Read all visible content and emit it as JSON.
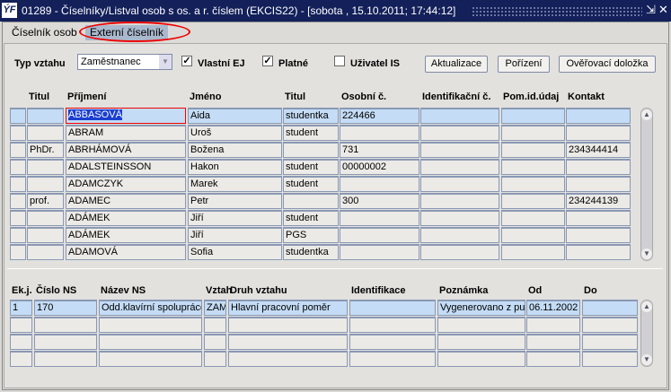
{
  "window": {
    "logo": "ÝF",
    "title": "01289 - Číselníky/Listval osob s os. a r. číslem (EKCIS22) - [sobota , 15.10.2011; 17:44:12]",
    "minimize": "⇲",
    "close": "✕"
  },
  "tabs": [
    {
      "label": "Číselník osob"
    },
    {
      "label": "Externí číselník"
    }
  ],
  "filters": {
    "typ_label": "Typ vztahu",
    "typ_value": "Zaměstnanec",
    "vlastni_ej": "Vlastní EJ",
    "vlastni_checked": true,
    "platne": "Platné",
    "platne_checked": true,
    "uzivatel": "Uživatel IS",
    "uzivatel_checked": false
  },
  "buttons": {
    "aktualizace": "Aktualizace",
    "porizeni": "Pořízení",
    "overovaci": "Ověřovací doložka"
  },
  "persons": {
    "headers": [
      "",
      "Titul",
      "Příjmení",
      "Jméno",
      "Titul",
      "Osobní č.",
      "Identifikační č.",
      "Pom.id.údaj",
      "Kontakt"
    ],
    "rows": [
      [
        "",
        "",
        "ABBASOVÁ",
        "Aida",
        "studentka",
        "224466",
        "",
        "",
        ""
      ],
      [
        "",
        "",
        "ABRAM",
        "Uroš",
        "student",
        "",
        "",
        "",
        ""
      ],
      [
        "",
        "PhDr.",
        "ABRHÁMOVÁ",
        "Božena",
        "",
        "731",
        "",
        "",
        "234344414"
      ],
      [
        "",
        "",
        "ADALSTEINSSON",
        "Hakon",
        "student",
        "00000002",
        "",
        "",
        ""
      ],
      [
        "",
        "",
        "ADAMCZYK",
        "Marek",
        "student",
        "",
        "",
        "",
        ""
      ],
      [
        "",
        "prof.",
        "ADAMEC",
        "Petr",
        "",
        "300",
        "",
        "",
        "234244139"
      ],
      [
        "",
        "",
        "ADÁMEK",
        "Jiří",
        "student",
        "",
        "",
        "",
        ""
      ],
      [
        "",
        "",
        "ADÁMEK",
        "Jiří",
        "PGS",
        "",
        "",
        "",
        ""
      ],
      [
        "",
        "",
        "ADAMOVÁ",
        "Sofia",
        "studentka",
        "",
        "",
        "",
        ""
      ]
    ]
  },
  "relations": {
    "headers": [
      "Ek.j.",
      "Číslo NS",
      "Název NS",
      "Vztah",
      "Druh vztahu",
      "Identifikace",
      "Poznámka",
      "Od",
      "Do"
    ],
    "rows": [
      [
        "1",
        "170",
        "Odd.klavírní spolupráce",
        "ZAM",
        "Hlavní pracovní poměr",
        "",
        "Vygenerovano z pu",
        "06.11.2002",
        ""
      ],
      [
        "",
        "",
        "",
        "",
        "",
        "",
        "",
        "",
        ""
      ],
      [
        "",
        "",
        "",
        "",
        "",
        "",
        "",
        "",
        ""
      ],
      [
        "",
        "",
        "",
        "",
        "",
        "",
        "",
        "",
        ""
      ]
    ]
  }
}
